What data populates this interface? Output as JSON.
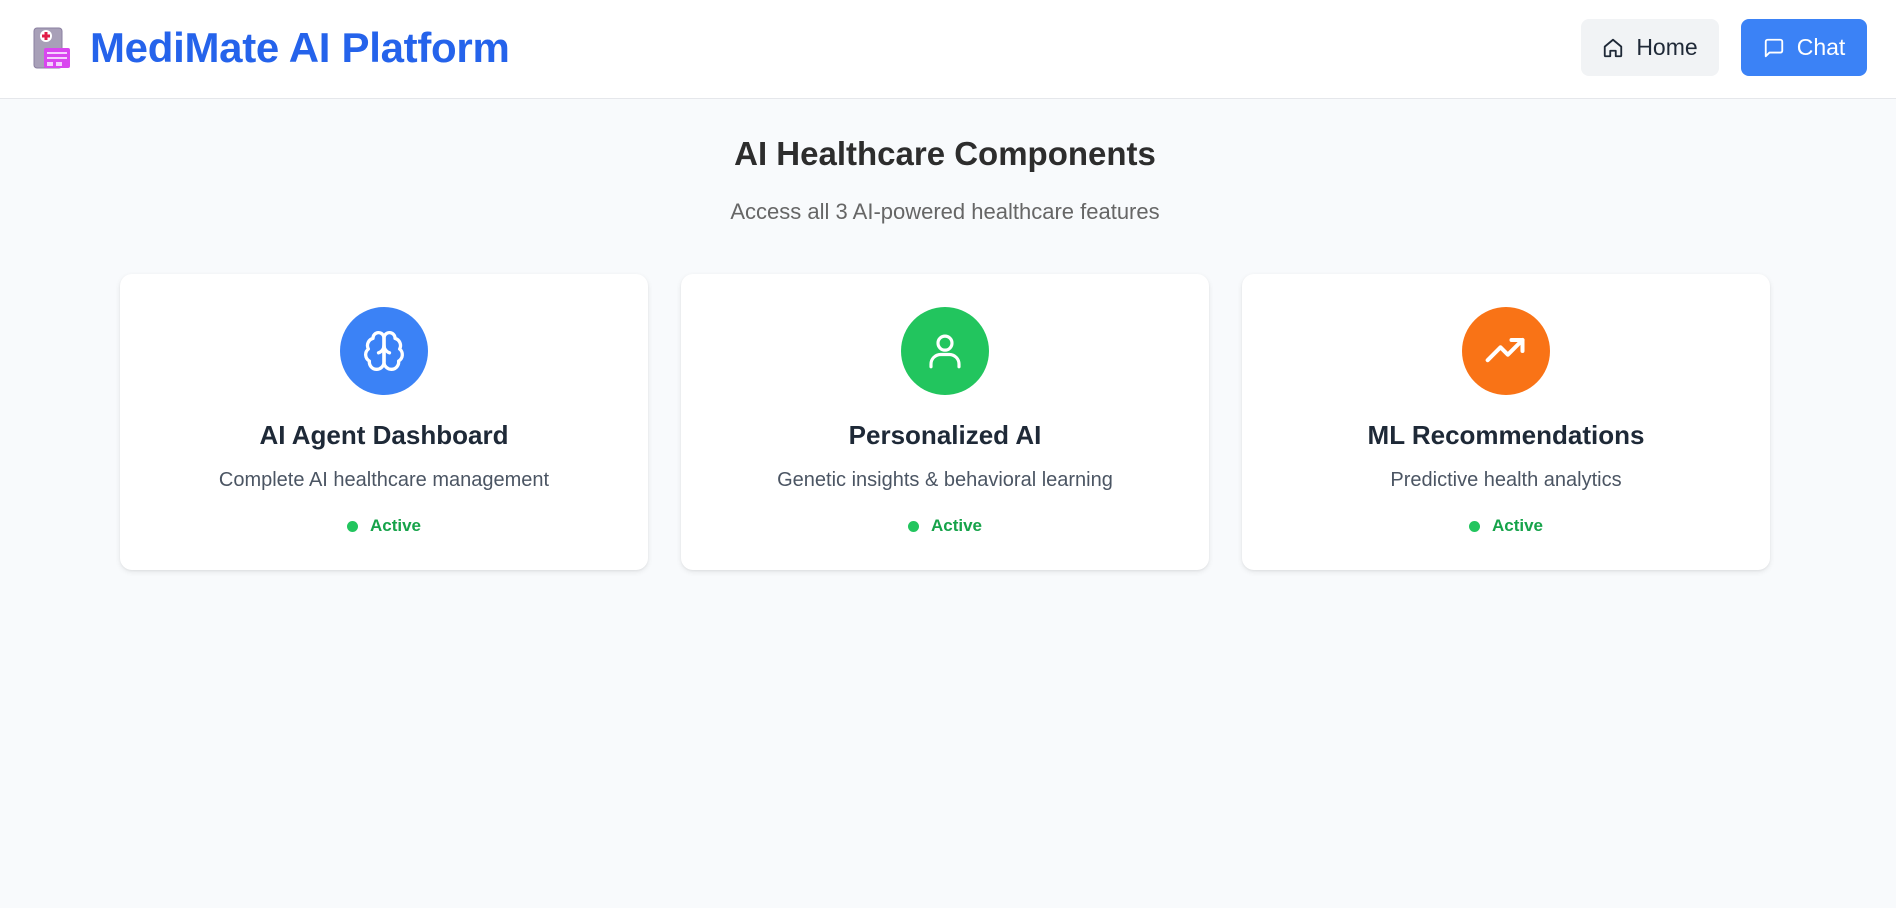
{
  "header": {
    "brand_icon": "hospital-icon",
    "title": "MediMate AI Platform",
    "home_label": "Home",
    "chat_label": "Chat"
  },
  "main": {
    "title": "AI Healthcare Components",
    "subtitle": "Access all 3 AI-powered healthcare features"
  },
  "cards": [
    {
      "icon": "brain-icon",
      "icon_bg": "#3b82f6",
      "title": "AI Agent Dashboard",
      "description": "Complete AI healthcare management",
      "status": "Active"
    },
    {
      "icon": "user-icon",
      "icon_bg": "#22c55e",
      "title": "Personalized AI",
      "description": "Genetic insights & behavioral learning",
      "status": "Active"
    },
    {
      "icon": "trending-up-icon",
      "icon_bg": "#f97316",
      "title": "ML Recommendations",
      "description": "Predictive health analytics",
      "status": "Active"
    }
  ],
  "colors": {
    "brand": "#2563eb",
    "chat_button": "#3b82f6",
    "status_active": "#22c55e",
    "status_text": "#16a34a"
  }
}
